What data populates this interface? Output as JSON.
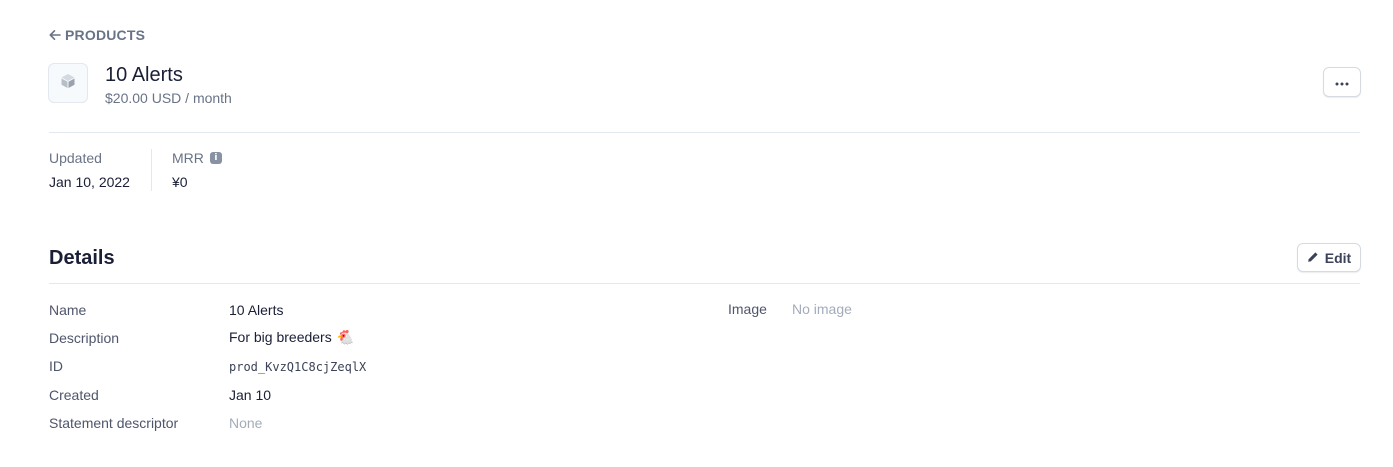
{
  "breadcrumb": {
    "back_label": "PRODUCTS",
    "back_icon": "arrow-left-icon"
  },
  "product": {
    "icon": "box-icon",
    "title": "10 Alerts",
    "price_line": "$20.00 USD / month",
    "more_icon": "more-horizontal-icon"
  },
  "stats": {
    "updated": {
      "label": "Updated",
      "value": "Jan 10, 2022"
    },
    "mrr": {
      "label": "MRR",
      "value": "¥0",
      "info_icon": "info-icon"
    }
  },
  "details": {
    "title": "Details",
    "edit_label": "Edit",
    "edit_icon": "pencil-icon",
    "fields": {
      "name": {
        "label": "Name",
        "value": "10 Alerts"
      },
      "description": {
        "label": "Description",
        "value": "For big breeders",
        "emoji": "🐔"
      },
      "id": {
        "label": "ID",
        "value": "prod_KvzQ1C8cjZeqlX"
      },
      "created": {
        "label": "Created",
        "value": "Jan 10"
      },
      "statement_descriptor": {
        "label": "Statement descriptor",
        "value": "None"
      }
    },
    "image": {
      "label": "Image",
      "value": "No image"
    }
  },
  "colors": {
    "text_primary": "#1a1f36",
    "text_secondary": "#697386",
    "text_muted": "#a3acb9",
    "border": "#e3e8ee"
  }
}
